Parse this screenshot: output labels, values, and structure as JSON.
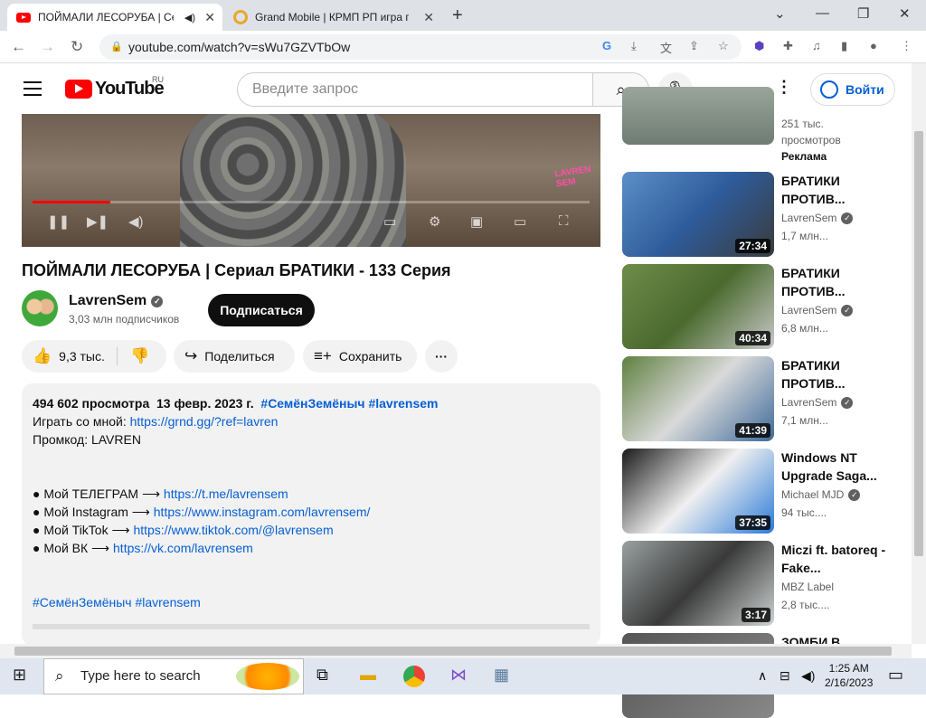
{
  "browser": {
    "tabs": [
      {
        "title": "ПОЙМАЛИ ЛЕСОРУБА | Сериал БРАТИКИ - 133 Серия",
        "active": true
      },
      {
        "title": "Grand Mobile | КРМП РП игра по сети",
        "active": false
      }
    ],
    "url": "youtube.com/watch?v=sWu7GZVTbOw"
  },
  "youtube": {
    "logo_text": "YouTube",
    "region": "RU",
    "search_placeholder": "Введите запрос",
    "login_label": "Войти"
  },
  "video": {
    "title": "ПОЙМАЛИ ЛЕСОРУБА | Сериал БРАТИКИ - 133 Серия",
    "watermark": "LAVREN SEM",
    "progress": 0.14,
    "channel": "LavrenSem",
    "subscribers": "3,03 млн подписчиков",
    "subscribe_label": "Подписаться",
    "likes": "9,3 тыс.",
    "share_label": "Поделиться",
    "save_label": "Сохранить"
  },
  "description": {
    "views": "494 602 просмотра",
    "date": "13 февр. 2023 г.",
    "tags": "#СемёнЗемёныч #lavrensem",
    "lines": [
      {
        "text": "Играть со мной: ",
        "link": "https://grnd.gg/?ref=lavren"
      },
      {
        "text": "Промкод: LAVREN",
        "link": ""
      },
      {
        "text": "",
        "link": ""
      },
      {
        "text": "",
        "link": ""
      },
      {
        "text": "● Мой ТЕЛЕГРАМ ⟶ ",
        "link": "https://t.me/lavrensem"
      },
      {
        "text": "● Мой Instagram ⟶ ",
        "link": "https://www.instagram.com/lavrensem/"
      },
      {
        "text": "● Мой TikTok ⟶ ",
        "link": "https://www.tiktok.com/@lavrensem"
      },
      {
        "text": "● Мой ВК ⟶ ",
        "link": "https://vk.com/lavrensem"
      },
      {
        "text": "",
        "link": ""
      },
      {
        "text": "",
        "link": ""
      },
      {
        "text": "",
        "link": "#СемёнЗемёныч #lavrensem"
      }
    ]
  },
  "sidebar": {
    "ad": {
      "views": "251 тыс.",
      "views2": "просмотров",
      "label": "Реклама"
    },
    "items": [
      {
        "title": "БРАТИКИ ПРОТИВ...",
        "channel": "LavrenSem",
        "views": "1,7 млн...",
        "duration": "27:34",
        "verified": true,
        "bg": "linear-gradient(135deg,#5d8fc7,#2e5c9a 50%,#3b3b3b)"
      },
      {
        "title": "БРАТИКИ ПРОТИВ...",
        "channel": "LavrenSem",
        "views": "6,8 млн...",
        "duration": "40:34",
        "verified": true,
        "bg": "linear-gradient(135deg,#6e8d4a,#4a6a2e 50%,#c9c9c9)"
      },
      {
        "title": "БРАТИКИ ПРОТИВ...",
        "channel": "LavrenSem",
        "views": "7,1 млн...",
        "duration": "41:39",
        "verified": true,
        "bg": "linear-gradient(135deg,#5f8040,#d9d9d9 50%,#3e6a9a)"
      },
      {
        "title": "Windows NT Upgrade Saga...",
        "channel": "Michael MJD",
        "views": "94 тыс....",
        "duration": "37:35",
        "verified": true,
        "bg": "linear-gradient(135deg,#1a1a1a,#f0f0f0 50%,#2a7ad8)"
      },
      {
        "title": "Miczi ft. batoreq - Fake...",
        "channel": "MBZ Label",
        "views": "2,8 тыс....",
        "duration": "3:17",
        "verified": false,
        "bg": "linear-gradient(135deg,#9aa0a0,#3a3a3a 50%,#cfd3d3)"
      },
      {
        "title": "ЗОМБИ В",
        "channel": "",
        "views": "",
        "duration": "",
        "verified": false,
        "bg": "linear-gradient(135deg,#555,#888)"
      }
    ]
  },
  "taskbar": {
    "search_placeholder": "Type here to search",
    "time": "1:25 AM",
    "date": "2/16/2023"
  }
}
